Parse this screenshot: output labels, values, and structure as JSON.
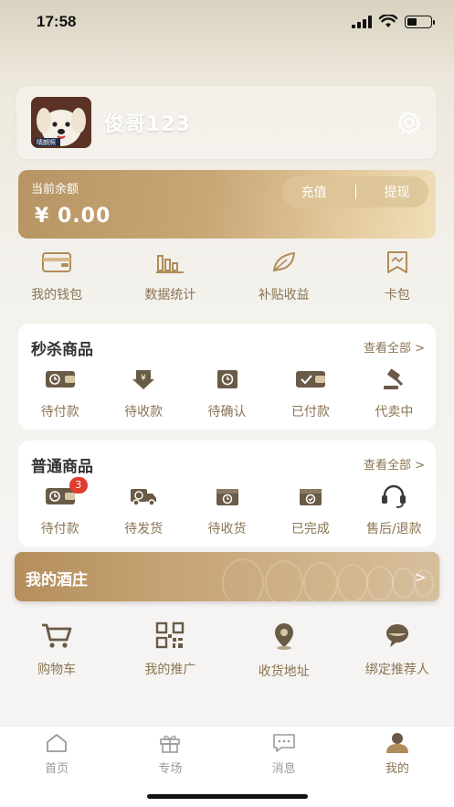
{
  "status": {
    "time": "17:58"
  },
  "profile": {
    "username": "俊哥123",
    "avatar_caption": "晴朗照"
  },
  "balance": {
    "label": "当前余额",
    "value": "¥ 0.00",
    "recharge": "充值",
    "withdraw": "提现"
  },
  "quick": [
    {
      "label": "我的钱包",
      "icon": "wallet-icon"
    },
    {
      "label": "数据统计",
      "icon": "bar-chart-icon"
    },
    {
      "label": "补贴收益",
      "icon": "leaf-icon"
    },
    {
      "label": "卡包",
      "icon": "card-bag-icon"
    }
  ],
  "flash": {
    "title": "秒杀商品",
    "more": "查看全部 >",
    "items": [
      {
        "label": "待付款",
        "icon": "wallet-clock-icon"
      },
      {
        "label": "待收款",
        "icon": "yen-down-icon"
      },
      {
        "label": "待确认",
        "icon": "clock-box-icon"
      },
      {
        "label": "已付款",
        "icon": "wallet-check-icon"
      },
      {
        "label": "代卖中",
        "icon": "auction-hammer-icon"
      }
    ]
  },
  "normal": {
    "title": "普通商品",
    "more": "查看全部 >",
    "items": [
      {
        "label": "待付款",
        "icon": "wallet-clock-icon",
        "badge": "3"
      },
      {
        "label": "待发货",
        "icon": "truck-icon"
      },
      {
        "label": "待收货",
        "icon": "box-clock-icon"
      },
      {
        "label": "已完成",
        "icon": "box-check-icon"
      },
      {
        "label": "售后/退款",
        "icon": "headset-icon"
      }
    ]
  },
  "winery": {
    "title": "我的酒庄",
    "arrow": ">"
  },
  "tools": [
    {
      "label": "购物车",
      "icon": "cart-icon"
    },
    {
      "label": "我的推广",
      "icon": "qr-code-icon"
    },
    {
      "label": "收货地址",
      "icon": "location-pin-icon"
    },
    {
      "label": "绑定推荐人",
      "icon": "chat-bubble-icon"
    }
  ],
  "tabs": [
    {
      "label": "首页",
      "icon": "home-icon",
      "active": false
    },
    {
      "label": "专场",
      "icon": "gift-icon",
      "active": false
    },
    {
      "label": "消息",
      "icon": "message-icon",
      "active": false
    },
    {
      "label": "我的",
      "icon": "user-icon",
      "active": true
    }
  ],
  "colors": {
    "accent": "#8a7452",
    "gold": "#c6a274",
    "badge": "#e23b2f"
  }
}
